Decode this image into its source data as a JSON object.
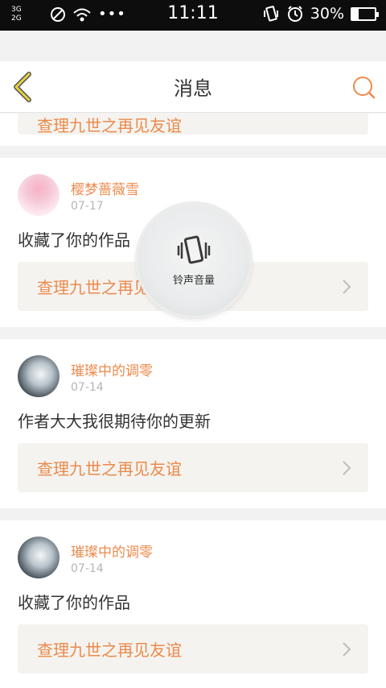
{
  "status_bar": {
    "network_top": "3G",
    "network_bottom": "2G",
    "time": "11:11",
    "battery_percent": "30%",
    "battery_level": 0.3
  },
  "header": {
    "title": "消息"
  },
  "partial_card": {
    "link_text": "查理九世之再见友谊"
  },
  "messages": [
    {
      "username": "樱梦蔷薇雪",
      "date": "07-17",
      "text": "收藏了你的作品",
      "link_text": "查理九世之再见友谊"
    },
    {
      "username": "璀璨中的调零",
      "date": "07-14",
      "text": "作者大大我很期待你的更新",
      "link_text": "查理九世之再见友谊"
    },
    {
      "username": "璀璨中的调零",
      "date": "07-14",
      "text": "收藏了你的作品",
      "link_text": "查理九世之再见友谊"
    }
  ],
  "volume_toast": {
    "label": "铃声音量"
  },
  "colors": {
    "accent": "#ec8a4c",
    "back_icon": "#e6d23c",
    "card_link_bg": "#f4f3ef"
  }
}
